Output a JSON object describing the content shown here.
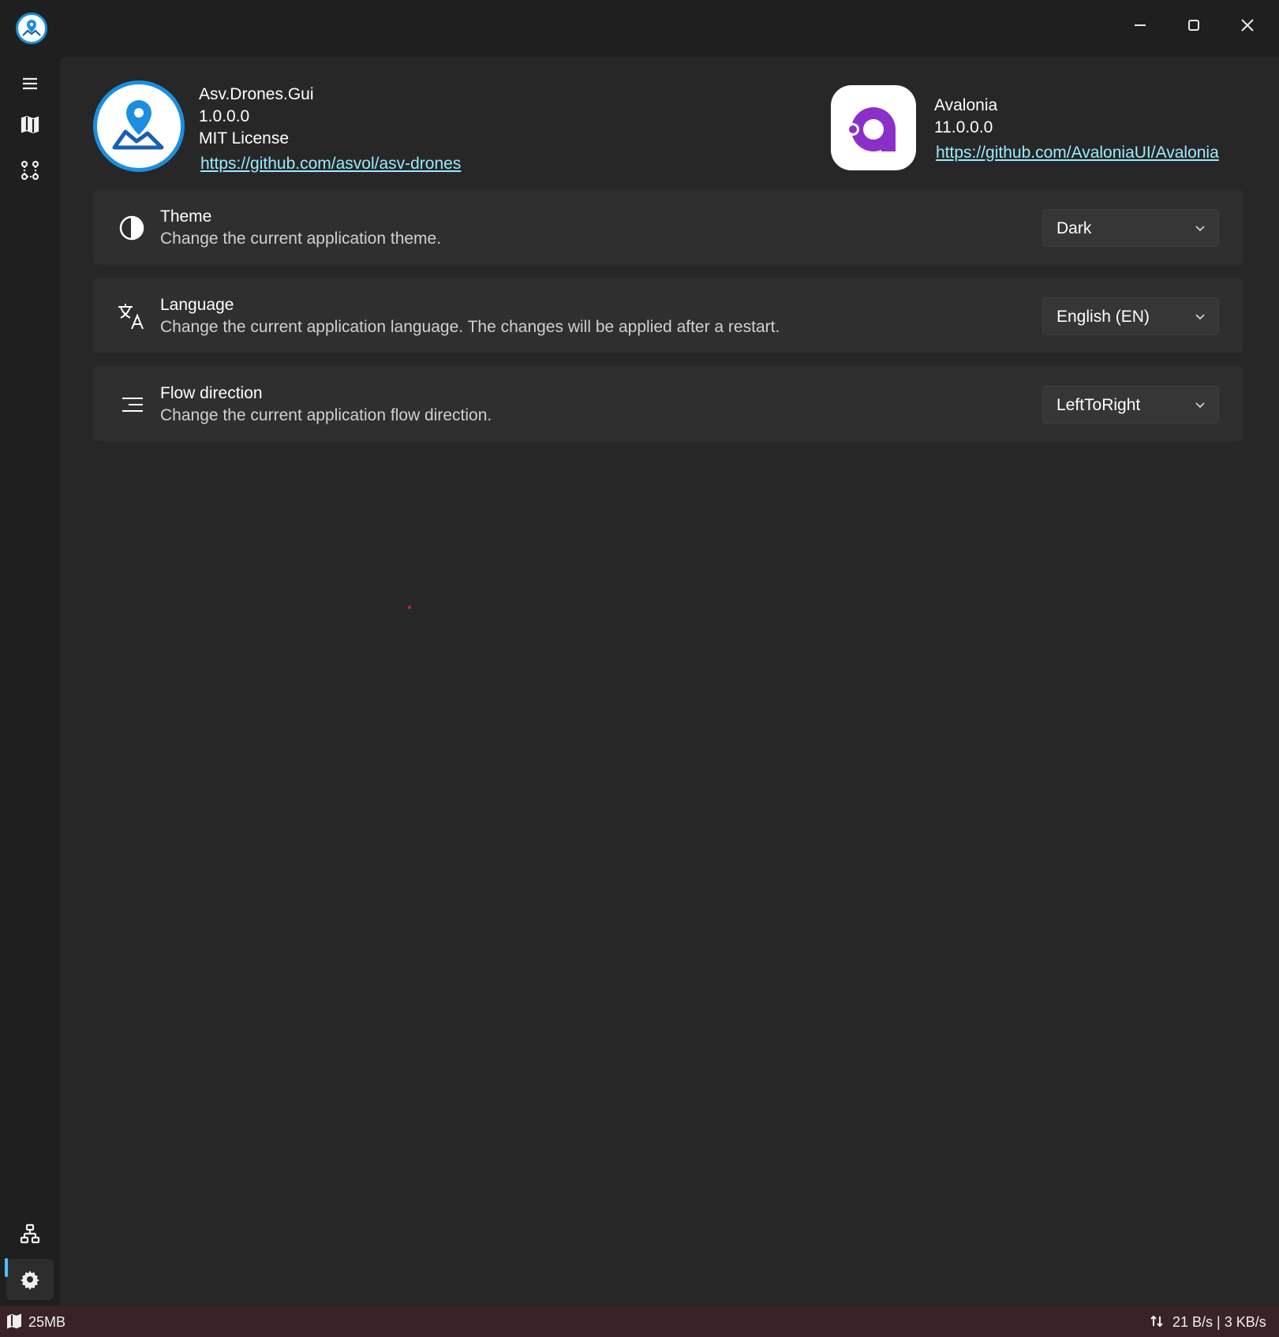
{
  "window": {
    "icons": {
      "app": "app-map-pin-icon",
      "minimize": "minimize-icon",
      "maximize": "maximize-icon",
      "close": "close-icon"
    }
  },
  "nav": {
    "items": [
      {
        "name": "menu",
        "icon": "hamburger-menu-icon"
      },
      {
        "name": "map",
        "icon": "map-icon"
      },
      {
        "name": "flight-plan",
        "icon": "route-icon"
      },
      {
        "name": "connections",
        "icon": "network-icon"
      },
      {
        "name": "settings",
        "icon": "gear-icon",
        "active": true
      }
    ],
    "accent": "#4cc2ff"
  },
  "about": {
    "app": {
      "name": "Asv.Drones.Gui",
      "version": "1.0.0.0",
      "license": "MIT License",
      "url": "https://github.com/asvol/asv-drones"
    },
    "framework": {
      "name": "Avalonia",
      "version": "11.0.0.0",
      "url": "https://github.com/AvaloniaUI/Avalonia"
    },
    "link_color": "#99ebff",
    "brand_blue": "#1a8fe0",
    "avalonia_purple": "#8b2fc9"
  },
  "settings": [
    {
      "icon": "theme-half-circle-icon",
      "title": "Theme",
      "description": "Change the current application theme.",
      "selected": "Dark"
    },
    {
      "icon": "translate-icon",
      "title": "Language",
      "description": "Change the current application language. The changes will be applied after a restart.",
      "selected": "English (EN)"
    },
    {
      "icon": "text-align-right-icon",
      "title": "Flow direction",
      "description": "Change the current application flow direction.",
      "selected": "LeftToRight"
    }
  ],
  "statusbar": {
    "map_cache": "25MB",
    "traffic": "21  B/s | 3   KB/s",
    "background": "#3a2326"
  }
}
